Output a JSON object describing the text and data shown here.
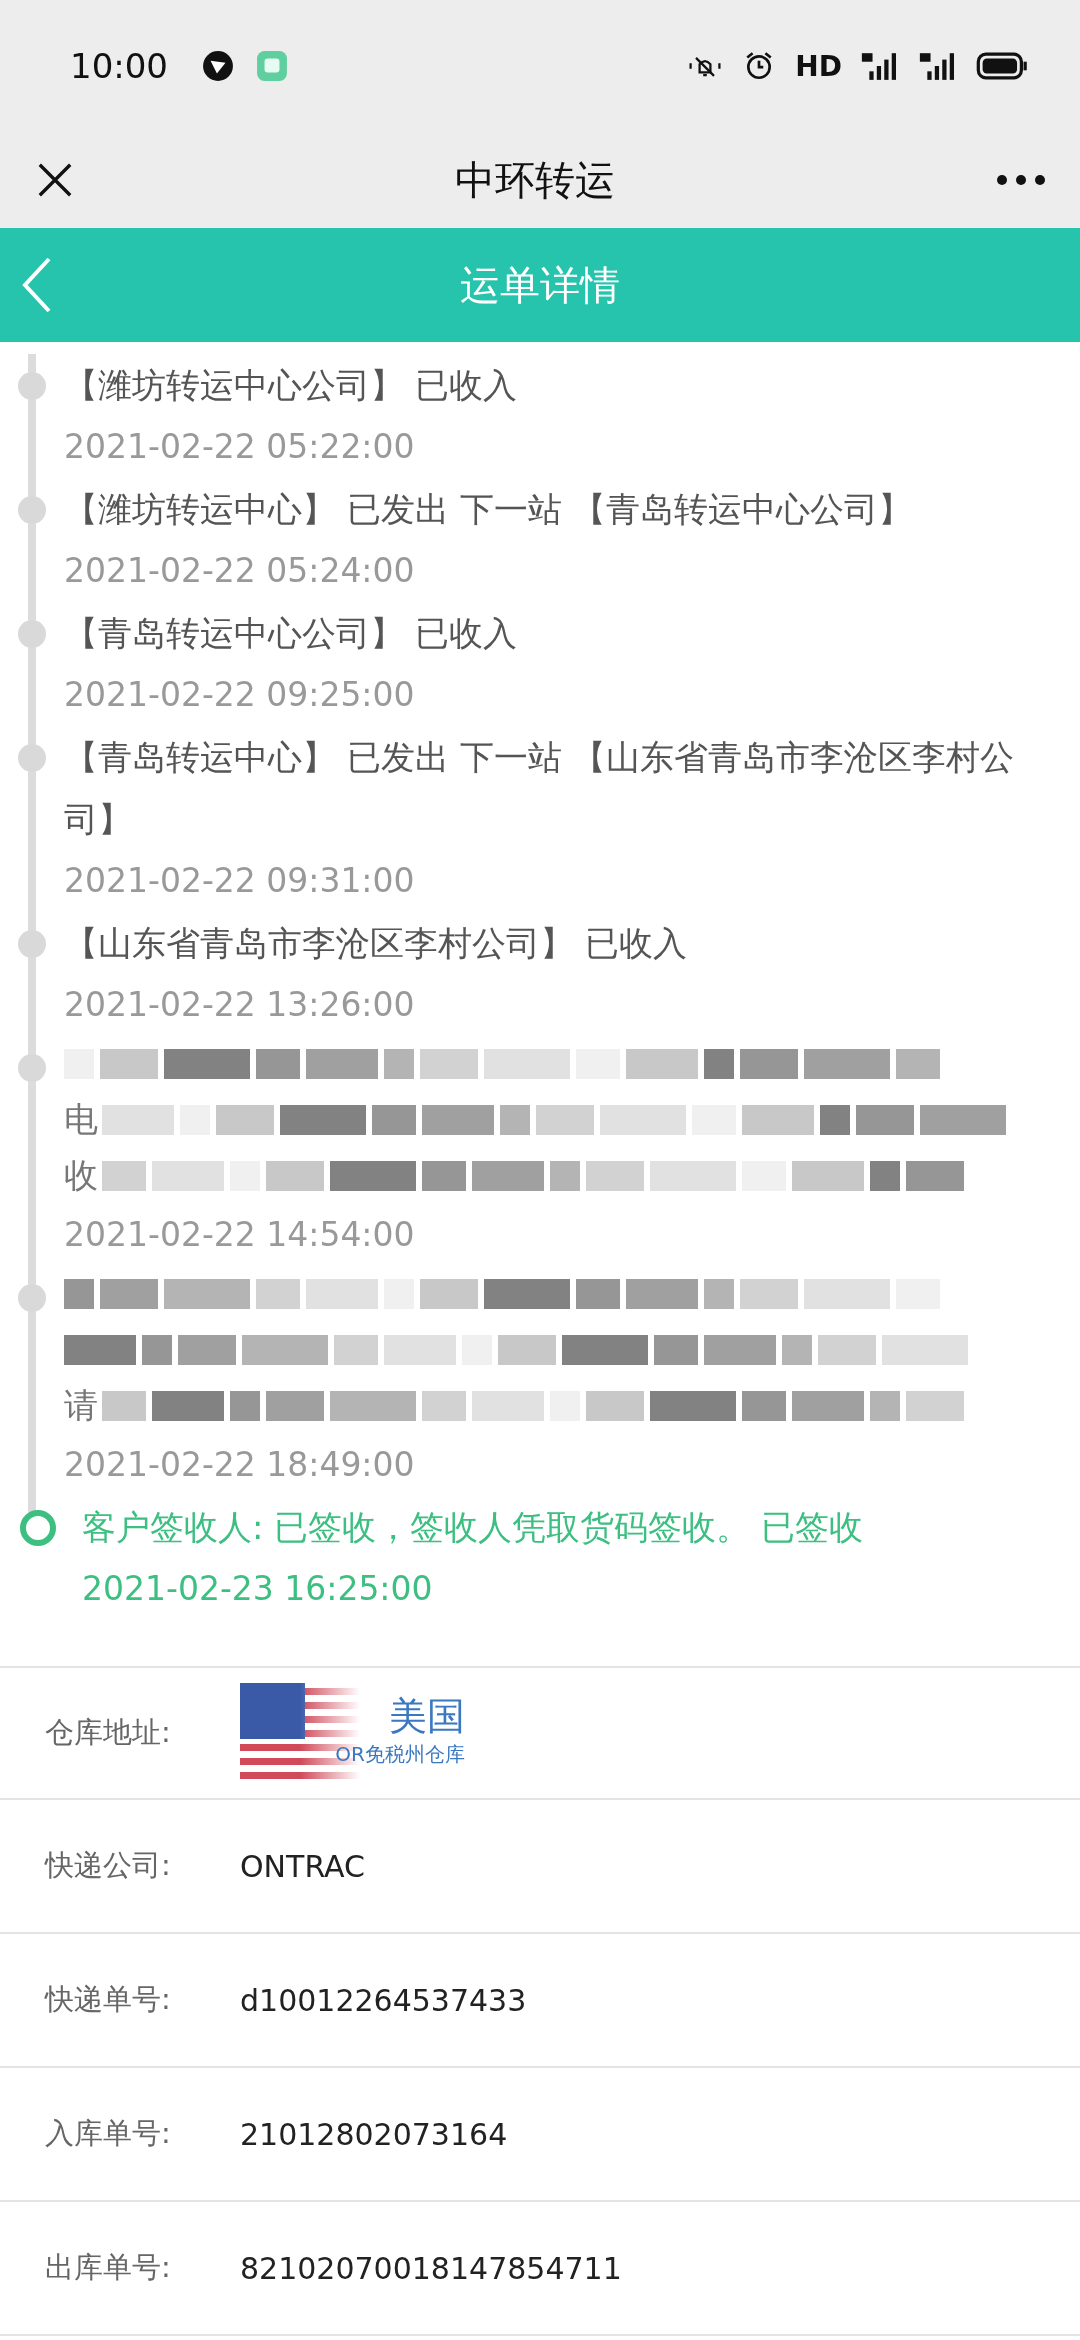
{
  "status_bar": {
    "time": "10:00",
    "network_label": "HD"
  },
  "title_bar": {
    "title": "中环转运"
  },
  "header": {
    "title": "运单详情"
  },
  "timeline": [
    {
      "kind": "plain",
      "text": "【潍坊转运中心公司】 已收入",
      "time": "2021-02-22 05:22:00"
    },
    {
      "kind": "plain",
      "text": "【潍坊转运中心】 已发出 下一站 【青岛转运中心公司】",
      "time": "2021-02-22 05:24:00"
    },
    {
      "kind": "plain",
      "text": "【青岛转运中心公司】 已收入",
      "time": "2021-02-22 09:25:00"
    },
    {
      "kind": "plain",
      "text": "【青岛转运中心】 已发出 下一站 【山东省青岛市李沧区李村公司】",
      "time": "2021-02-22 09:31:00"
    },
    {
      "kind": "plain",
      "text": "【山东省青岛市李沧区李村公司】 已收入",
      "time": "2021-02-22 13:26:00"
    },
    {
      "kind": "redacted",
      "visible": [
        "电",
        "收"
      ],
      "time": "2021-02-22 14:54:00"
    },
    {
      "kind": "redacted",
      "visible": [
        "请"
      ],
      "time": "2021-02-22 18:49:00"
    },
    {
      "kind": "latest",
      "text": "客户签收人: 已签收，签收人凭取货码签收。 已签收",
      "time": "2021-02-23 16:25:00"
    }
  ],
  "details": [
    {
      "kind": "warehouse",
      "label": "仓库地址:",
      "value": "美国",
      "subtitle": "OR免税州仓库"
    },
    {
      "kind": "text",
      "label": "快递公司:",
      "value": "ONTRAC"
    },
    {
      "kind": "text",
      "label": "快递单号:",
      "value": "d10012264537433"
    },
    {
      "kind": "text",
      "label": "入库单号:",
      "value": "21012802073164"
    },
    {
      "kind": "text",
      "label": "出库单号:",
      "value": "82102070018147854711"
    }
  ]
}
